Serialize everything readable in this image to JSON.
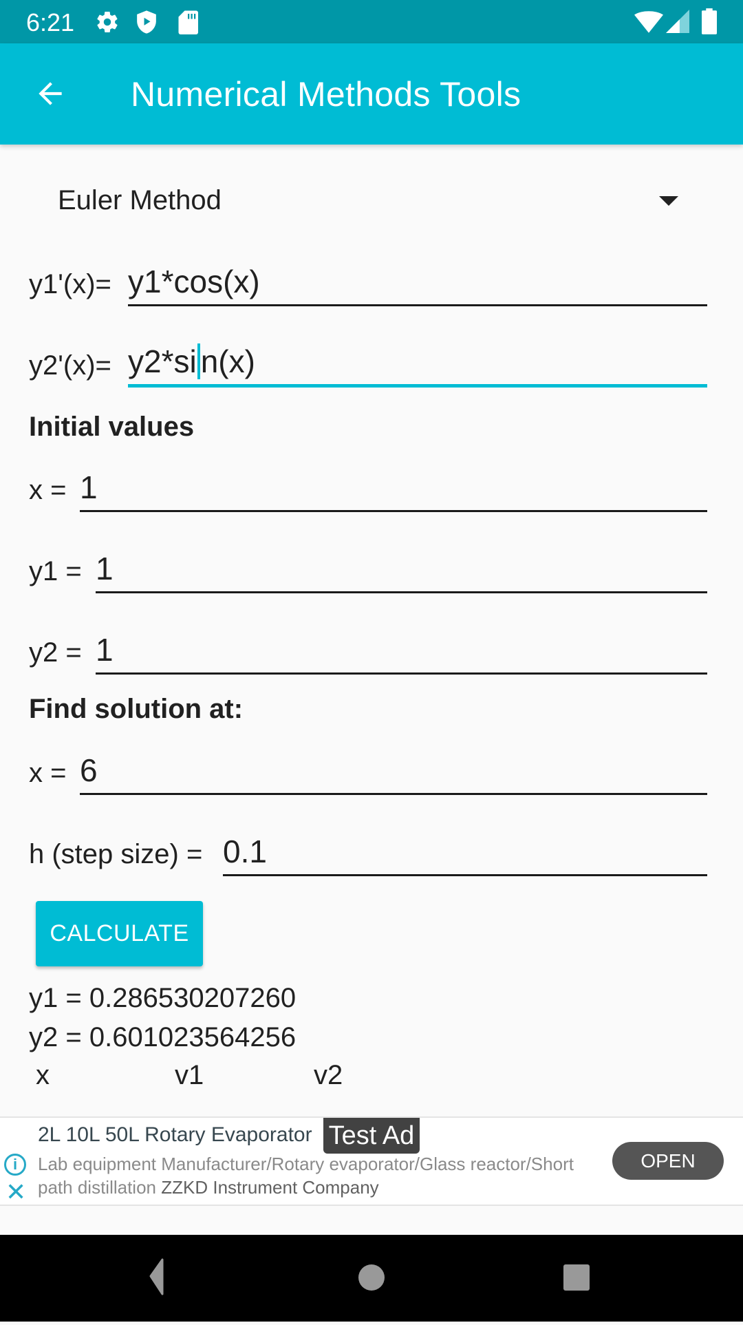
{
  "status_bar": {
    "time": "6:21",
    "left_icons": [
      "gear-icon",
      "shield-play-icon",
      "sd-card-icon"
    ],
    "right_icons": [
      "wifi-icon",
      "cell-signal-icon",
      "battery-icon"
    ]
  },
  "app_bar": {
    "title": "Numerical Methods Tools",
    "back_icon": "arrow-back-icon"
  },
  "method_selector": {
    "selected": "Euler Method"
  },
  "equations": {
    "y1_label": "y1'(x)=",
    "y1_value": "y1*cos(x)",
    "y2_label": "y2'(x)=",
    "y2_value_before_cursor": "y2*si",
    "y2_value_after_cursor": "n(x)"
  },
  "initial_values": {
    "heading": "Initial values",
    "x_label": "x =",
    "x_value": "1",
    "y1_label": "y1 =",
    "y1_value": "1",
    "y2_label": "y2 =",
    "y2_value": "1"
  },
  "find_solution": {
    "heading": "Find solution at:",
    "x_label": "x =",
    "x_value": "6",
    "h_label": "h (step size) =",
    "h_value": "0.1"
  },
  "calculate_button": "CALCULATE",
  "results": {
    "y1": "y1 = 0.286530207260",
    "y2": "y2 = 0.601023564256",
    "columns": [
      "x",
      "v1",
      "v2"
    ]
  },
  "ad": {
    "badge": "Test Ad",
    "headline": "2L 10L 50L Rotary Evaporator",
    "body": "Lab equipment Manufacturer/Rotary evaporator/Glass reactor/Short path distillation",
    "advertiser": "ZZKD Instrument Company",
    "cta": "OPEN"
  },
  "colors": {
    "status_bar": "#0097a7",
    "primary": "#00bcd4",
    "background": "#fafafa"
  }
}
